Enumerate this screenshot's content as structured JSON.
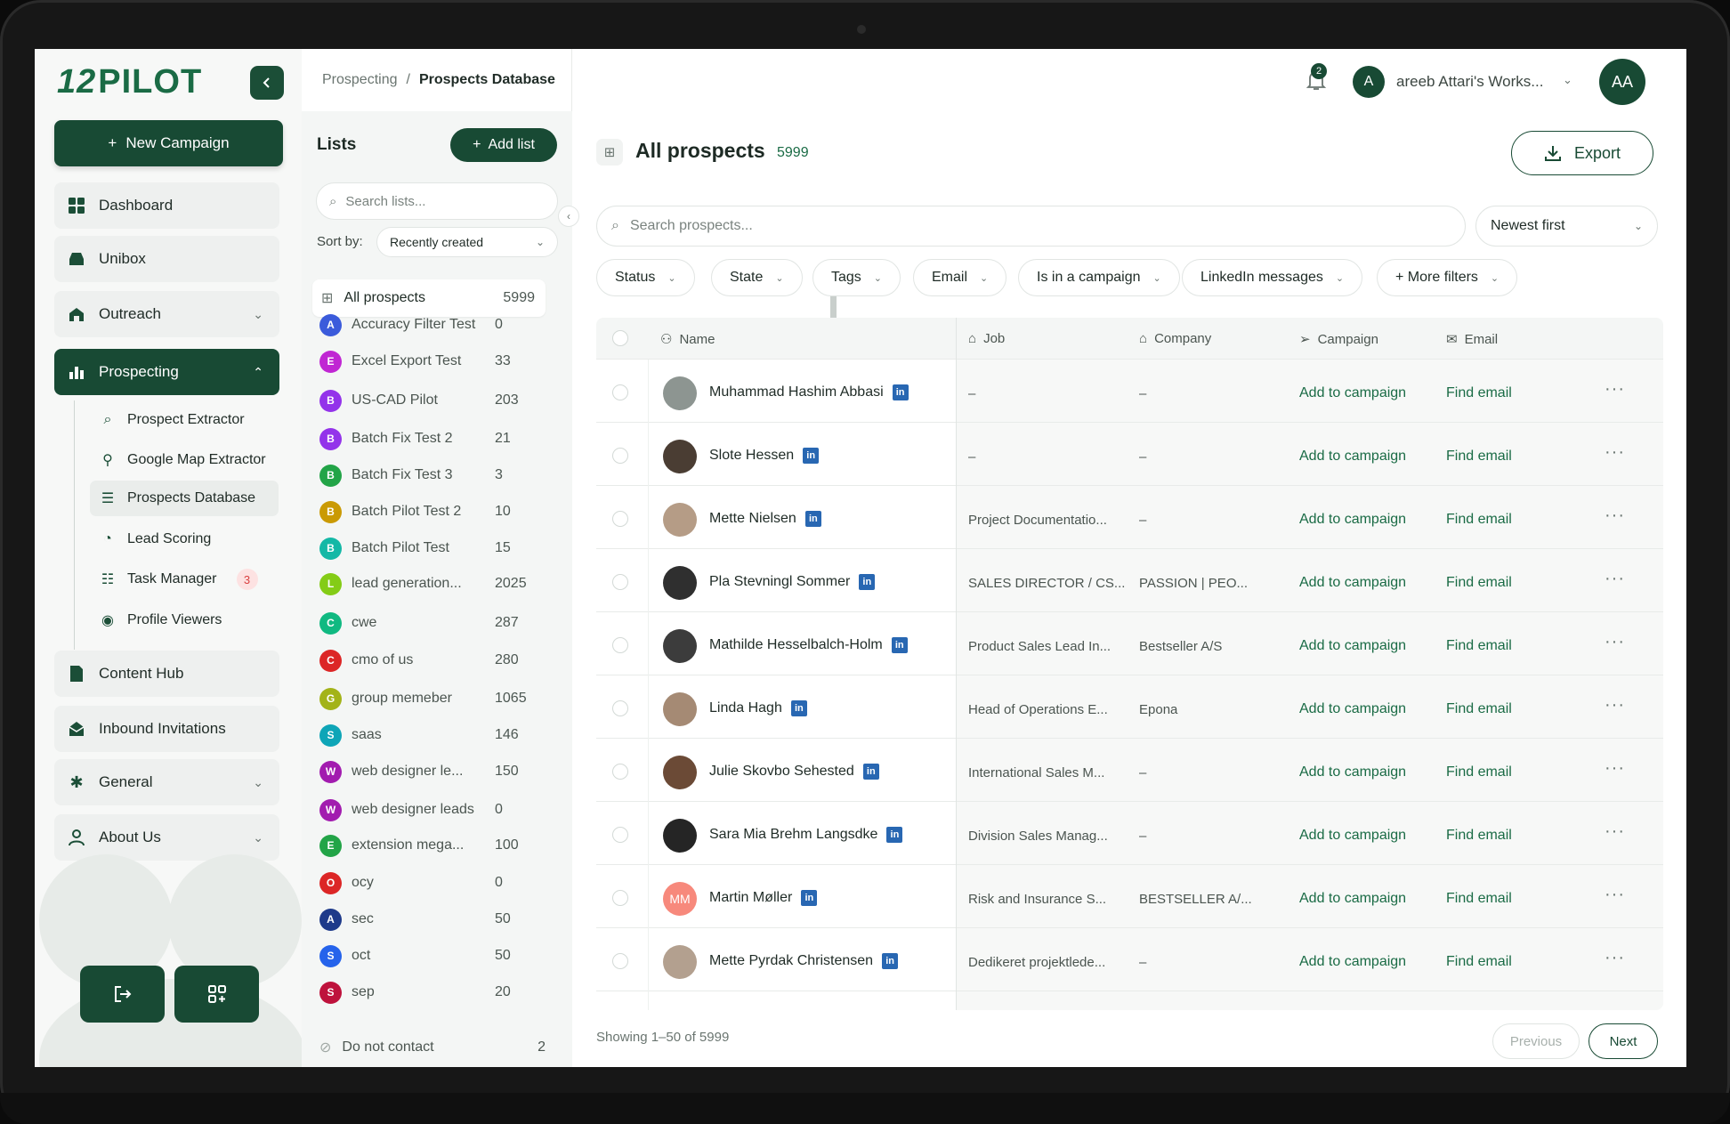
{
  "brand": {
    "logo_mark": "12",
    "logo_text": "PILOT"
  },
  "sidebar": {
    "new_campaign": "New Campaign",
    "items": [
      {
        "label": "Dashboard"
      },
      {
        "label": "Unibox"
      },
      {
        "label": "Outreach"
      },
      {
        "label": "Prospecting"
      },
      {
        "label": "Content Hub"
      },
      {
        "label": "Inbound Invitations"
      },
      {
        "label": "General"
      },
      {
        "label": "About Us"
      }
    ],
    "sub_items": [
      {
        "label": "Prospect Extractor"
      },
      {
        "label": "Google Map Extractor"
      },
      {
        "label": "Prospects Database"
      },
      {
        "label": "Lead Scoring"
      },
      {
        "label": "Task Manager",
        "badge": "3"
      },
      {
        "label": "Profile Viewers"
      }
    ]
  },
  "breadcrumb": {
    "parent": "Prospecting",
    "separator": "/",
    "current": "Prospects Database"
  },
  "topbar": {
    "notifications": "2",
    "workspace_initial": "A",
    "workspace_name": "areeb Attari's Works...",
    "user_initials": "AA"
  },
  "lists": {
    "title": "Lists",
    "add_label": "Add list",
    "search_placeholder": "Search lists...",
    "sort_label": "Sort by:",
    "sort_value": "Recently created",
    "all": {
      "label": "All prospects",
      "count": "5999"
    },
    "items": [
      {
        "initial": "A",
        "name": "Accuracy Filter Test",
        "count": "0",
        "color": "#3b5bdb"
      },
      {
        "initial": "E",
        "name": "Excel Export Test",
        "count": "33",
        "color": "#c026d3"
      },
      {
        "initial": "B",
        "name": "US-CAD Pilot",
        "count": "203",
        "color": "#9333ea"
      },
      {
        "initial": "B",
        "name": "Batch Fix Test 2",
        "count": "21",
        "color": "#9333ea"
      },
      {
        "initial": "B",
        "name": "Batch Fix Test 3",
        "count": "3",
        "color": "#22a447"
      },
      {
        "initial": "B",
        "name": "Batch Pilot Test 2",
        "count": "10",
        "color": "#ca9a04"
      },
      {
        "initial": "B",
        "name": "Batch Pilot Test",
        "count": "15",
        "color": "#14b8a6"
      },
      {
        "initial": "L",
        "name": "lead generation...",
        "count": "2025",
        "color": "#84cc16"
      },
      {
        "initial": "C",
        "name": "cwe",
        "count": "287",
        "color": "#10b981"
      },
      {
        "initial": "C",
        "name": "cmo of us",
        "count": "280",
        "color": "#dc2626"
      },
      {
        "initial": "G",
        "name": "group memeber",
        "count": "1065",
        "color": "#a3b318"
      },
      {
        "initial": "S",
        "name": "saas",
        "count": "146",
        "color": "#0ea5b7"
      },
      {
        "initial": "W",
        "name": "web designer le...",
        "count": "150",
        "color": "#a21caf"
      },
      {
        "initial": "W",
        "name": "web designer leads",
        "count": "0",
        "color": "#a21caf"
      },
      {
        "initial": "E",
        "name": "extension mega...",
        "count": "100",
        "color": "#22a447"
      },
      {
        "initial": "O",
        "name": "ocy",
        "count": "0",
        "color": "#dc2626"
      },
      {
        "initial": "A",
        "name": "sec",
        "count": "50",
        "color": "#1e3a8a"
      },
      {
        "initial": "S",
        "name": "oct",
        "count": "50",
        "color": "#2563eb"
      },
      {
        "initial": "S",
        "name": "sep",
        "count": "20",
        "color": "#be123c"
      }
    ],
    "do_not_contact": {
      "label": "Do not contact",
      "count": "2"
    }
  },
  "main": {
    "title": "All prospects",
    "count": "5999",
    "export_label": "Export",
    "search_placeholder": "Search prospects...",
    "sort_value": "Newest first",
    "filters": [
      "Status",
      "State",
      "Tags",
      "Email",
      "Is in a campaign",
      "LinkedIn messages",
      "+ More filters"
    ],
    "columns": {
      "name": "Name",
      "job": "Job",
      "company": "Company",
      "campaign": "Campaign",
      "email": "Email"
    },
    "rows": [
      {
        "name": "Muhammad Hashim Abbasi",
        "job": "–",
        "company": "–",
        "campaign": "Add to campaign",
        "email": "Find email",
        "avatar_color": "#8d9591",
        "initials": ""
      },
      {
        "name": "Slote Hessen",
        "job": "–",
        "company": "–",
        "campaign": "Add to campaign",
        "email": "Find email",
        "avatar_color": "#4a3d33",
        "initials": ""
      },
      {
        "name": "Mette Nielsen",
        "job": "Project Documentatio...",
        "company": "–",
        "campaign": "Add to campaign",
        "email": "Find email",
        "avatar_color": "#b59c86",
        "initials": ""
      },
      {
        "name": "Pla Stevningl Sommer",
        "job": "SALES DIRECTOR / CS...",
        "company": "PASSION | PEO...",
        "campaign": "Add to campaign",
        "email": "Find email",
        "avatar_color": "#2f2f2f",
        "initials": ""
      },
      {
        "name": "Mathilde Hesselbalch-Holm",
        "job": "Product Sales Lead In...",
        "company": "Bestseller A/S",
        "campaign": "Add to campaign",
        "email": "Find email",
        "avatar_color": "#3c3c3c",
        "initials": ""
      },
      {
        "name": "Linda Hagh",
        "job": "Head of Operations E...",
        "company": "Epona",
        "campaign": "Add to campaign",
        "email": "Find email",
        "avatar_color": "#a58a74",
        "initials": ""
      },
      {
        "name": "Julie Skovbo Sehested",
        "job": "International Sales M...",
        "company": "–",
        "campaign": "Add to campaign",
        "email": "Find email",
        "avatar_color": "#6b4a36",
        "initials": ""
      },
      {
        "name": "Sara Mia Brehm Langsdke",
        "job": "Division Sales Manag...",
        "company": "–",
        "campaign": "Add to campaign",
        "email": "Find email",
        "avatar_color": "#252525",
        "initials": ""
      },
      {
        "name": "Martin Møller",
        "job": "Risk and Insurance S...",
        "company": "BESTSELLER A/...",
        "campaign": "Add to campaign",
        "email": "Find email",
        "avatar_color": "#f7897c",
        "initials": "MM"
      },
      {
        "name": "Mette Pyrdak Christensen",
        "job": "Dedikeret projektlede...",
        "company": "–",
        "campaign": "Add to campaign",
        "email": "Find email",
        "avatar_color": "#b3a08f",
        "initials": ""
      }
    ],
    "showing": "Showing 1–50 of 5999",
    "prev_label": "Previous",
    "next_label": "Next"
  }
}
